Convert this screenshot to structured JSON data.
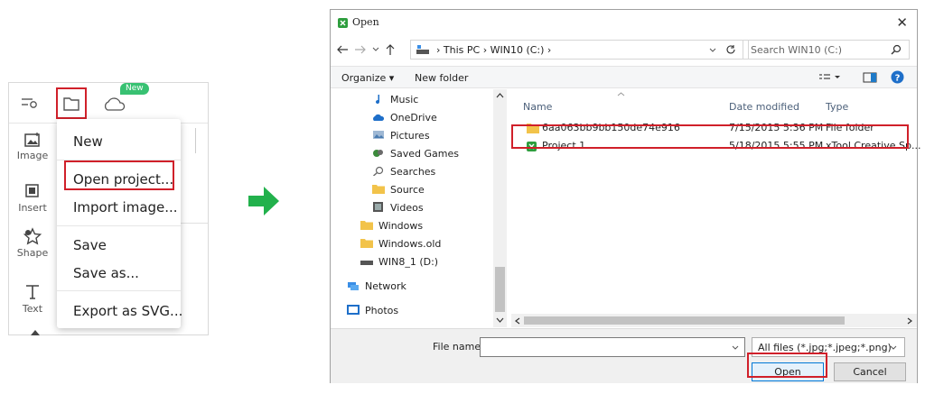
{
  "app": {
    "new_badge": "New",
    "tools": [
      {
        "label": "Image"
      },
      {
        "label": "Insert"
      },
      {
        "label": "Shape"
      },
      {
        "label": "Text"
      }
    ],
    "menu": {
      "new": "New",
      "open_project": "Open project...",
      "import_image": "Import image...",
      "save": "Save",
      "save_as": "Save as...",
      "export_svg": "Export as SVG..."
    }
  },
  "dialog": {
    "title": "Open",
    "close": "✕",
    "breadcrumb": [
      "This PC",
      "WIN10 (C:)"
    ],
    "search_placeholder": "Search WIN10 (C:)",
    "organize": "Organize ▾",
    "new_folder": "New folder",
    "nav_items": [
      {
        "label": "Music",
        "icon": "music-icon"
      },
      {
        "label": "OneDrive",
        "icon": "cloud-icon"
      },
      {
        "label": "Pictures",
        "icon": "pictures-icon"
      },
      {
        "label": "Saved Games",
        "icon": "games-icon"
      },
      {
        "label": "Searches",
        "icon": "search-icon"
      },
      {
        "label": "Source",
        "icon": "folder-icon"
      },
      {
        "label": "Videos",
        "icon": "videos-icon"
      },
      {
        "label": "Windows",
        "icon": "folder-icon"
      },
      {
        "label": "Windows.old",
        "icon": "folder-icon"
      },
      {
        "label": "WIN8_1 (D:)",
        "icon": "drive-icon"
      },
      {
        "label": "Network",
        "icon": "network-icon"
      },
      {
        "label": "Photos",
        "icon": "photos-icon"
      }
    ],
    "columns": {
      "name": "Name",
      "date": "Date modified",
      "type": "Type"
    },
    "files": [
      {
        "name": "6aa063bb9bb150de74e916",
        "date": "7/15/2015 5:36 PM",
        "type": "File folder"
      },
      {
        "name": "Project 1",
        "date": "5/18/2015 5:55 PM",
        "type": "xTool Creative Sp..."
      }
    ],
    "file_name_label": "File name:",
    "file_name_value": "",
    "filter": "All files (*.jpg;*.jpeg;*.png)",
    "open": "Open",
    "cancel": "Cancel"
  },
  "colors": {
    "highlight": "#d0202a",
    "arrow": "#22b14c",
    "badge": "#38c172"
  }
}
